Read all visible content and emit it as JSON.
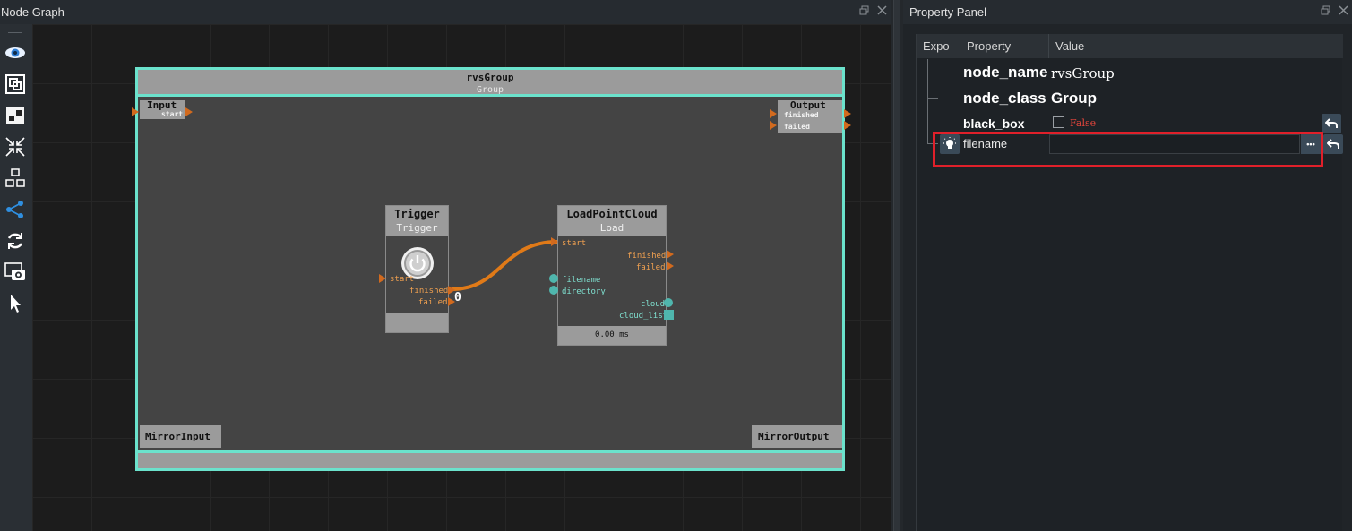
{
  "node_graph": {
    "title": "Node Graph",
    "float_icon": "float-icon",
    "close_icon": "close-icon",
    "toolbar": [
      "eye-icon",
      "frame-icon",
      "nodes-icon",
      "collapse-icon",
      "layout-icon",
      "connect-icon",
      "refresh-icon",
      "screenshot-icon",
      "pointer-icon"
    ],
    "group": {
      "title": "rvsGroup",
      "subtitle": "Group",
      "input": {
        "label": "Input",
        "ports": [
          "start"
        ]
      },
      "output": {
        "label": "Output",
        "ports": [
          "finished",
          "failed"
        ]
      },
      "mirror_input": "MirrorInput",
      "mirror_output": "MirrorOutput"
    },
    "nodes": {
      "trigger": {
        "title": "Trigger",
        "subtitle": "Trigger",
        "in_ports": [
          "start"
        ],
        "out_ports": [
          "finished",
          "failed"
        ],
        "finished_count": "0"
      },
      "load": {
        "title": "LoadPointCloud",
        "subtitle": "Load",
        "in_ports": [
          "start"
        ],
        "out_ports": [
          "finished",
          "failed"
        ],
        "data_in": [
          "filename",
          "directory"
        ],
        "data_out": [
          "cloud",
          "cloud_list"
        ],
        "timing": "0.00 ms"
      }
    },
    "colors": {
      "group_border": "#6be2cc",
      "exec_port": "#d26a1e",
      "data_port": "#4fb6ad",
      "wire": "#e07a18"
    }
  },
  "property_panel": {
    "title": "Property Panel",
    "columns": [
      "Expo",
      "Property",
      "Value"
    ],
    "rows": [
      {
        "name": "node_name",
        "value": "rvsGroup"
      },
      {
        "name": "node_class",
        "value": "Group"
      },
      {
        "name": "black_box",
        "value": "False",
        "checked": false
      },
      {
        "name": "filename",
        "value": "",
        "browse_label": "•••"
      }
    ],
    "highlight_color": "#e0202a"
  }
}
